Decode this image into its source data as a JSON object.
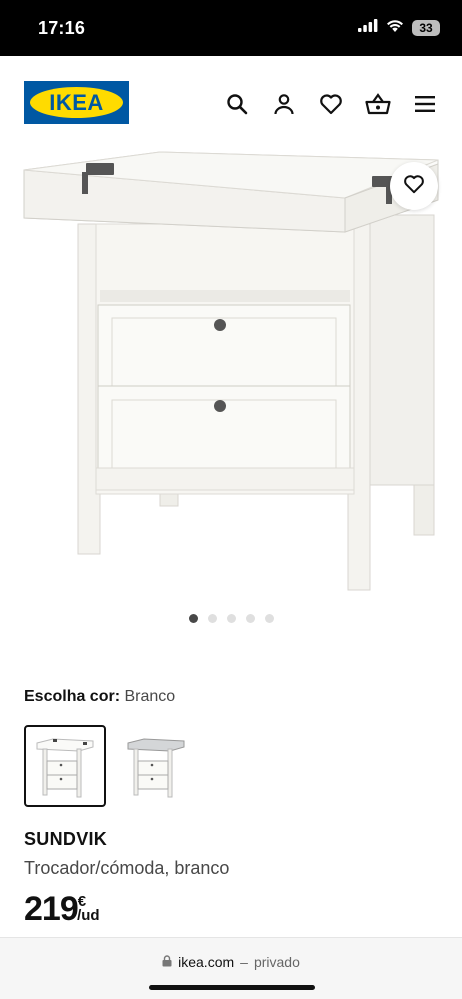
{
  "status": {
    "time": "17:16",
    "battery": "33"
  },
  "header": {
    "logo_text": "IKEA",
    "icons": [
      "search-icon",
      "user-icon",
      "heart-icon",
      "basket-icon",
      "menu-icon"
    ]
  },
  "gallery": {
    "image_count": 5,
    "active_index": 0
  },
  "color": {
    "label": "Escolha cor:",
    "value": "Branco"
  },
  "swatches": [
    {
      "name": "white",
      "selected": true
    },
    {
      "name": "grey",
      "selected": false
    }
  ],
  "product": {
    "name": "SUNDVIK",
    "description": "Trocador/cómoda, branco",
    "price": "219",
    "currency": "€",
    "unit": "/ud"
  },
  "browser": {
    "domain": "ikea.com",
    "separator": "–",
    "mode": "privado"
  },
  "colors": {
    "ikea_blue": "#0058a3",
    "ikea_yellow": "#ffdb00"
  }
}
